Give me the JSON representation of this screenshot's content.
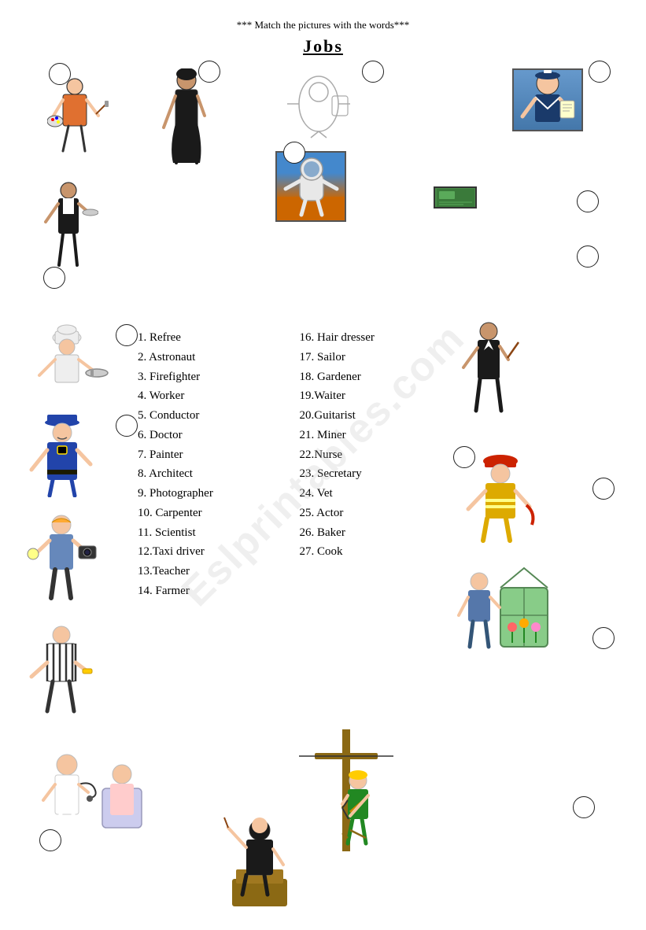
{
  "header": {
    "instruction": "*** Match the pictures with the words***",
    "title": "Jobs"
  },
  "words": {
    "left": [
      "1. Refree",
      "2. Astronaut",
      "3. Firefighter",
      "4.  Worker",
      "5. Conductor",
      "6. Doctor",
      "7. Painter",
      "8. Architect",
      "9. Photographer",
      "10.  Carpenter",
      "11.  Scientist",
      "12.Taxi driver",
      "13.Teacher",
      "14. Farmer"
    ],
    "right": [
      "16. Hair dresser",
      "17. Sailor",
      "18. Gardener",
      "19.Waiter",
      "20.Guitarist",
      "21. Miner",
      "22.Nurse",
      "23. Secretary",
      "24. Vet",
      "25. Actor",
      "26. Baker",
      "27. Cook"
    ]
  },
  "watermark": "Eslprintables.com"
}
